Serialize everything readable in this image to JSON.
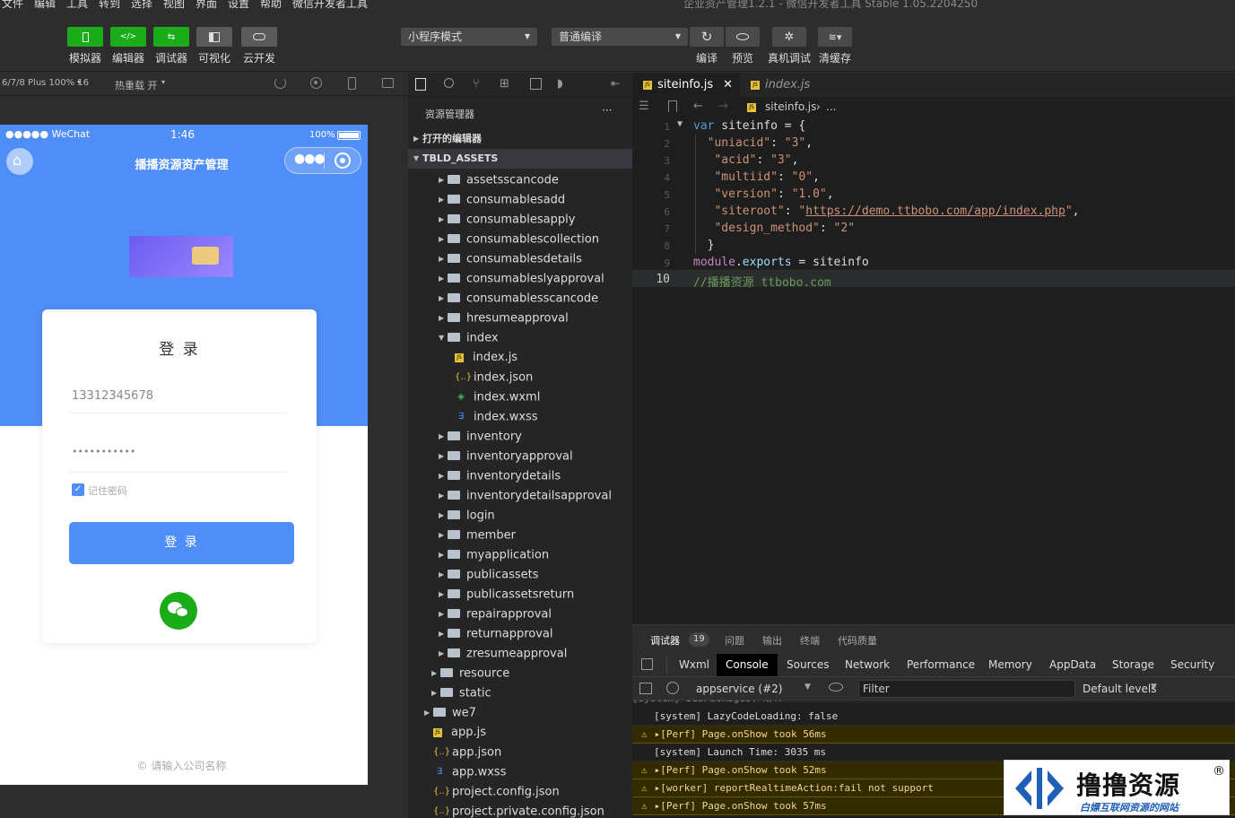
{
  "menubar": {
    "items": [
      "文件",
      "编辑",
      "工具",
      "转到",
      "选择",
      "视图",
      "界面",
      "设置",
      "帮助",
      "微信开发者工具"
    ],
    "title": "企业资产管理1.2.1 - 微信开发者工具 Stable 1.05.2204250"
  },
  "toolbar": {
    "buttons": [
      {
        "label": "模拟器",
        "icon": "phone-icon"
      },
      {
        "label": "编辑器",
        "icon": "code-icon"
      },
      {
        "label": "调试器",
        "icon": "debug-icon"
      },
      {
        "label": "可视化",
        "icon": "layout-icon"
      },
      {
        "label": "云开发",
        "icon": "cloud-icon"
      }
    ],
    "mode_select": "小程序模式",
    "compile_select": "普通编译",
    "right_buttons": [
      {
        "label": "编译",
        "icon": "refresh-icon"
      },
      {
        "label": "预览",
        "icon": "eye-icon"
      },
      {
        "label": "真机调试",
        "icon": "bug-icon"
      },
      {
        "label": "清缓存",
        "icon": "layers-icon"
      }
    ]
  },
  "simulator": {
    "device": "6/7/8 Plus 100% 16",
    "hot_reload": "热重载 开",
    "status_carrier": "●●●●● WeChat",
    "status_time": "1:46",
    "status_battery": "100%",
    "nav_title": "播播资源资产管理",
    "login_title": "登 录",
    "phone_value": "13312345678",
    "password_value": "•••••••••••",
    "remember_label": "记住密码",
    "login_button": "登 录",
    "footer": "© 请输入公司名称"
  },
  "explorer": {
    "title": "资源管理器",
    "more": "···",
    "open_editors": "打开的编辑器",
    "root": "TBLD_ASSETS",
    "items": [
      {
        "name": "assetsscancode",
        "type": "folder",
        "depth": 2
      },
      {
        "name": "consumablesadd",
        "type": "folder",
        "depth": 2
      },
      {
        "name": "consumablesapply",
        "type": "folder",
        "depth": 2
      },
      {
        "name": "consumablescollection",
        "type": "folder",
        "depth": 2
      },
      {
        "name": "consumablesdetails",
        "type": "folder",
        "depth": 2
      },
      {
        "name": "consumableslyapproval",
        "type": "folder",
        "depth": 2
      },
      {
        "name": "consumablesscancode",
        "type": "folder",
        "depth": 2
      },
      {
        "name": "hresumeapproval",
        "type": "folder",
        "depth": 2
      },
      {
        "name": "index",
        "type": "folder-open",
        "depth": 2
      },
      {
        "name": "index.js",
        "type": "js",
        "depth": 3
      },
      {
        "name": "index.json",
        "type": "json",
        "depth": 3
      },
      {
        "name": "index.wxml",
        "type": "wxml",
        "depth": 3
      },
      {
        "name": "index.wxss",
        "type": "wxss",
        "depth": 3
      },
      {
        "name": "inventory",
        "type": "folder",
        "depth": 2
      },
      {
        "name": "inventoryapproval",
        "type": "folder",
        "depth": 2
      },
      {
        "name": "inventorydetails",
        "type": "folder",
        "depth": 2
      },
      {
        "name": "inventorydetailsapproval",
        "type": "folder",
        "depth": 2
      },
      {
        "name": "login",
        "type": "folder",
        "depth": 2
      },
      {
        "name": "member",
        "type": "folder",
        "depth": 2
      },
      {
        "name": "myapplication",
        "type": "folder",
        "depth": 2
      },
      {
        "name": "publicassets",
        "type": "folder",
        "depth": 2
      },
      {
        "name": "publicassetsreturn",
        "type": "folder",
        "depth": 2
      },
      {
        "name": "repairapproval",
        "type": "folder",
        "depth": 2
      },
      {
        "name": "returnapproval",
        "type": "folder",
        "depth": 2
      },
      {
        "name": "zresumeapproval",
        "type": "folder",
        "depth": 2
      },
      {
        "name": "resource",
        "type": "folder",
        "depth": 1
      },
      {
        "name": "static",
        "type": "folder",
        "depth": 1
      },
      {
        "name": "we7",
        "type": "folder",
        "depth": 0
      },
      {
        "name": "app.js",
        "type": "js",
        "depth": 0
      },
      {
        "name": "app.json",
        "type": "json",
        "depth": 0
      },
      {
        "name": "app.wxss",
        "type": "wxss",
        "depth": 0
      },
      {
        "name": "project.config.json",
        "type": "json",
        "depth": 0
      },
      {
        "name": "project.private.config.json",
        "type": "json",
        "depth": 0
      }
    ]
  },
  "editor": {
    "tabs": [
      {
        "label": "siteinfo.js",
        "active": true
      },
      {
        "label": "index.js",
        "active": false
      }
    ],
    "breadcrumb_file": "siteinfo.js",
    "breadcrumb_symbol": "...",
    "lines": [
      {
        "n": "1",
        "html": "<span style='color:#569cd6'>var</span> siteinfo = {"
      },
      {
        "n": "2",
        "html": "  <span style='color:#ce9178'>\"uniacid\"</span>: <span style='color:#ce9178'>\"3\"</span>,"
      },
      {
        "n": "3",
        "html": "   <span style='color:#ce9178'>\"acid\"</span>: <span style='color:#ce9178'>\"3\"</span>,"
      },
      {
        "n": "4",
        "html": "   <span style='color:#ce9178'>\"multiid\"</span>: <span style='color:#ce9178'>\"0\"</span>,"
      },
      {
        "n": "5",
        "html": "   <span style='color:#ce9178'>\"version\"</span>: <span style='color:#ce9178'>\"1.0\"</span>,"
      },
      {
        "n": "6",
        "html": "   <span style='color:#ce9178'>\"siteroot\"</span>: <span style='color:#ce9178'>\"<u>https://demo.ttbobo.com/app/index.php</u>\"</span>,"
      },
      {
        "n": "7",
        "html": "   <span style='color:#ce9178'>\"design_method\"</span>: <span style='color:#ce9178'>\"2\"</span>"
      },
      {
        "n": "8",
        "html": "  }"
      },
      {
        "n": "9",
        "html": "<span style='color:#c586c0'>module</span>.<span style='color:#9cdcfe'>exports</span> = siteinfo"
      },
      {
        "n": "10",
        "html": "<span style='color:#6a9955'>//播播资源 ttbobo.com</span>"
      }
    ]
  },
  "devtools": {
    "top_tabs": [
      "调试器",
      "问题",
      "输出",
      "终端",
      "代码质量"
    ],
    "badge": "19",
    "tabs": [
      "Wxml",
      "Console",
      "Sources",
      "Network",
      "Performance",
      "Memory",
      "AppData",
      "Storage",
      "Security"
    ],
    "active_tab": "Console",
    "context": "appservice (#2)",
    "filter_placeholder": "Filter",
    "levels": "Default levels",
    "console": [
      {
        "text": "[system] LazyCodeLoading: false",
        "warn": false
      },
      {
        "text": "▸[Perf] Page.onShow took 56ms",
        "warn": true
      },
      {
        "text": "[system] Launch Time: 3035 ms",
        "warn": false
      },
      {
        "text": "▸[Perf] Page.onShow took 52ms",
        "warn": true
      },
      {
        "text": "▸[worker] reportRealtimeAction:fail not support",
        "warn": true
      },
      {
        "text": "▸[Perf] Page.onShow took 57ms",
        "warn": true
      }
    ]
  },
  "watermark": {
    "title": "撸撸资源",
    "subtitle": "白嫖互联网资源的网站",
    "reg": "®"
  }
}
